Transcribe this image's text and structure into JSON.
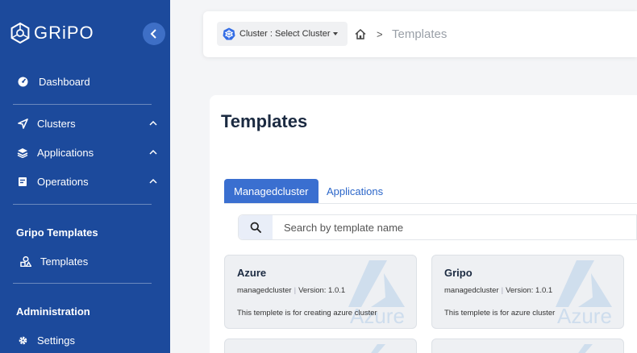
{
  "sidebar": {
    "logo_text": "GRiPO",
    "items": [
      {
        "label": "Dashboard"
      },
      {
        "label": "Clusters"
      },
      {
        "label": "Applications"
      },
      {
        "label": "Operations"
      }
    ],
    "sections": [
      {
        "title": "Gripo Templates",
        "items": [
          {
            "label": "Templates"
          }
        ]
      },
      {
        "title": "Administration",
        "items": [
          {
            "label": "Settings"
          }
        ]
      }
    ],
    "color": "#1c4a9c"
  },
  "topbar": {
    "cluster_select_label": "Cluster : Select Cluster",
    "breadcrumb_separator": ">",
    "breadcrumb_current": "Templates"
  },
  "main": {
    "title": "Templates",
    "tabs": [
      {
        "label": "Managedcluster",
        "active": true
      },
      {
        "label": "Applications",
        "active": false
      }
    ],
    "search": {
      "placeholder": "Search by template name",
      "value": ""
    },
    "cards": [
      {
        "title": "Azure",
        "type": "managedcluster",
        "version": "Version: 1.0.1",
        "description": "This templete is for creating azure cluster",
        "watermark": "Azure"
      },
      {
        "title": "Gripo",
        "type": "managedcluster",
        "version": "Version: 1.0.1",
        "description": "This templete is for azure cluster",
        "watermark": "Azure"
      }
    ],
    "accent_color": "#3a6fd0"
  }
}
